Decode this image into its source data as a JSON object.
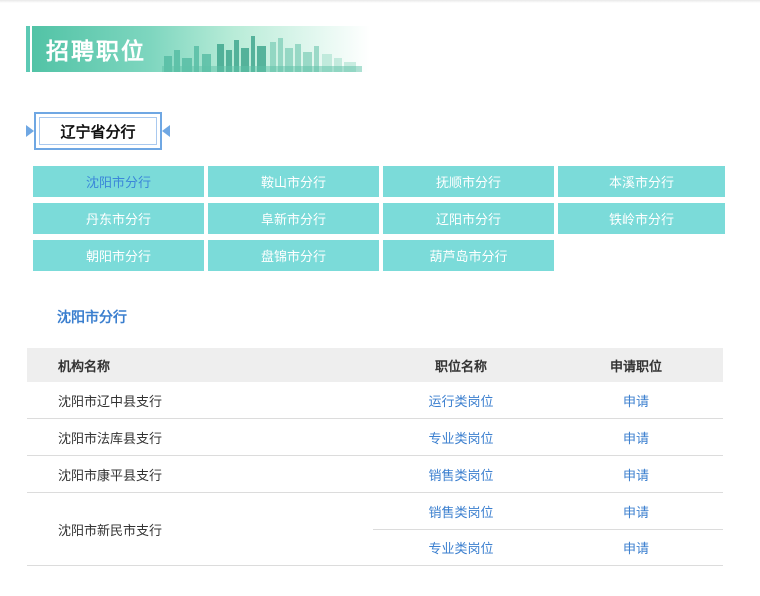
{
  "banner": {
    "title": "招聘职位"
  },
  "province": {
    "label": "辽宁省分行"
  },
  "branches": [
    {
      "label": "沈阳市分行",
      "active": true
    },
    {
      "label": "鞍山市分行",
      "active": false
    },
    {
      "label": "抚顺市分行",
      "active": false
    },
    {
      "label": "本溪市分行",
      "active": false
    },
    {
      "label": "丹东市分行",
      "active": false
    },
    {
      "label": "阜新市分行",
      "active": false
    },
    {
      "label": "辽阳市分行",
      "active": false
    },
    {
      "label": "铁岭市分行",
      "active": false
    },
    {
      "label": "朝阳市分行",
      "active": false
    },
    {
      "label": "盘锦市分行",
      "active": false
    },
    {
      "label": "葫芦岛市分行",
      "active": false
    }
  ],
  "selected_branch": "沈阳市分行",
  "table": {
    "headers": {
      "org": "机构名称",
      "position": "职位名称",
      "apply": "申请职位"
    },
    "rows": [
      {
        "org": "沈阳市辽中县支行",
        "jobs": [
          {
            "position": "运行类岗位",
            "apply": "申请"
          }
        ]
      },
      {
        "org": "沈阳市法库县支行",
        "jobs": [
          {
            "position": "专业类岗位",
            "apply": "申请"
          }
        ]
      },
      {
        "org": "沈阳市康平县支行",
        "jobs": [
          {
            "position": "销售类岗位",
            "apply": "申请"
          }
        ]
      },
      {
        "org": "沈阳市新民市支行",
        "jobs": [
          {
            "position": "销售类岗位",
            "apply": "申请"
          },
          {
            "position": "专业类岗位",
            "apply": "申请"
          }
        ]
      }
    ]
  },
  "colors": {
    "tile": "#7bdbd9",
    "tile_text": "#ffffff",
    "active_text": "#3b87d9",
    "link": "#3b7fcf",
    "banner": "#52c3a6",
    "province_border": "#6fa7e3"
  }
}
